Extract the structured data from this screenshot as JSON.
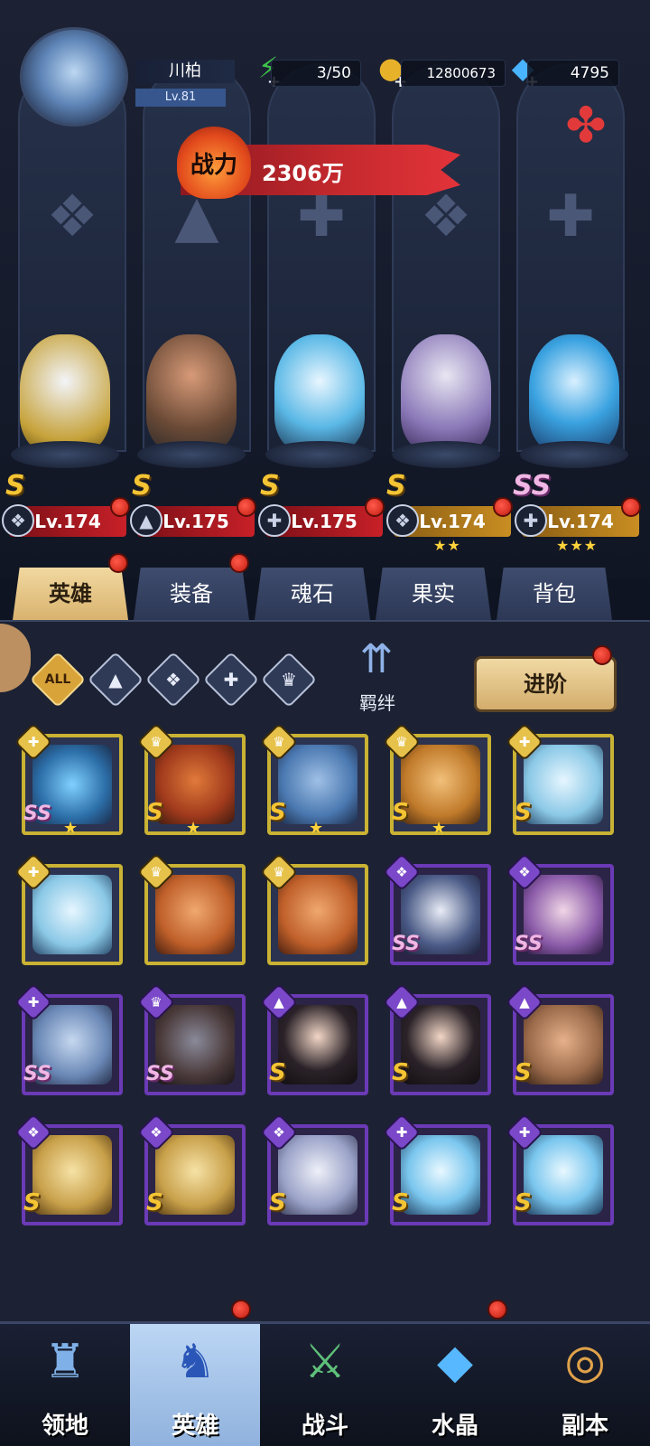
{
  "player": {
    "name": "川柏",
    "level": "Lv.81"
  },
  "resources": [
    {
      "name": "stamina",
      "value": "3/50",
      "icon": "lightning-icon",
      "color": "#3ec24a"
    },
    {
      "name": "gold",
      "value": "12800673",
      "icon": "coin-icon",
      "color": "#e8b12a"
    },
    {
      "name": "diamond",
      "value": "4795",
      "icon": "diamond-icon",
      "color": "#49b4ff"
    }
  ],
  "power": {
    "label": "战力",
    "value": "2306万"
  },
  "lineup": [
    {
      "level": "Lv.174",
      "grade": "S",
      "color": "red",
      "class": "wing",
      "stars": ""
    },
    {
      "level": "Lv.175",
      "grade": "S",
      "color": "red",
      "class": "tower",
      "stars": ""
    },
    {
      "level": "Lv.175",
      "grade": "S",
      "color": "red",
      "class": "wrench",
      "stars": ""
    },
    {
      "level": "Lv.174",
      "grade": "S",
      "color": "gold",
      "class": "wing",
      "stars": "★★"
    },
    {
      "level": "Lv.174",
      "grade": "SS",
      "color": "gold",
      "class": "wrench",
      "stars": "★★★"
    }
  ],
  "tabs": [
    "英雄",
    "装备",
    "魂石",
    "果实",
    "背包"
  ],
  "filters": {
    "all": "ALL",
    "bond": "羁绊",
    "advance": "进阶"
  },
  "heroes": [
    {
      "grade": "SS",
      "frame": "gold",
      "class": "wrench",
      "star": "★"
    },
    {
      "grade": "S",
      "frame": "gold",
      "class": "claw",
      "star": "★"
    },
    {
      "grade": "S",
      "frame": "gold",
      "class": "claw",
      "star": "★"
    },
    {
      "grade": "S",
      "frame": "gold",
      "class": "claw",
      "star": "★"
    },
    {
      "grade": "S",
      "frame": "gold",
      "class": "wrench",
      "star": ""
    },
    {
      "grade": "",
      "frame": "gold",
      "class": "wrench",
      "star": ""
    },
    {
      "grade": "",
      "frame": "gold",
      "class": "claw",
      "star": ""
    },
    {
      "grade": "",
      "frame": "gold",
      "class": "claw",
      "star": ""
    },
    {
      "grade": "SS",
      "frame": "purple",
      "class": "wing",
      "star": ""
    },
    {
      "grade": "SS",
      "frame": "purple",
      "class": "wing",
      "star": ""
    },
    {
      "grade": "SS",
      "frame": "purple",
      "class": "wrench",
      "star": ""
    },
    {
      "grade": "SS",
      "frame": "purple",
      "class": "claw",
      "star": ""
    },
    {
      "grade": "S",
      "frame": "purple",
      "class": "tower",
      "star": ""
    },
    {
      "grade": "S",
      "frame": "purple",
      "class": "tower",
      "star": ""
    },
    {
      "grade": "S",
      "frame": "purple",
      "class": "tower",
      "star": ""
    },
    {
      "grade": "S",
      "frame": "purple",
      "class": "wing",
      "star": ""
    },
    {
      "grade": "S",
      "frame": "purple",
      "class": "wing",
      "star": ""
    },
    {
      "grade": "S",
      "frame": "purple",
      "class": "wing",
      "star": ""
    },
    {
      "grade": "S",
      "frame": "purple",
      "class": "wrench",
      "star": ""
    },
    {
      "grade": "S",
      "frame": "purple",
      "class": "wrench",
      "star": ""
    }
  ],
  "nav": [
    {
      "label": "领地",
      "icon": "castle-icon"
    },
    {
      "label": "英雄",
      "icon": "hero-icon"
    },
    {
      "label": "战斗",
      "icon": "battle-icon"
    },
    {
      "label": "水晶",
      "icon": "crystal-icon"
    },
    {
      "label": "副本",
      "icon": "portal-icon"
    }
  ]
}
